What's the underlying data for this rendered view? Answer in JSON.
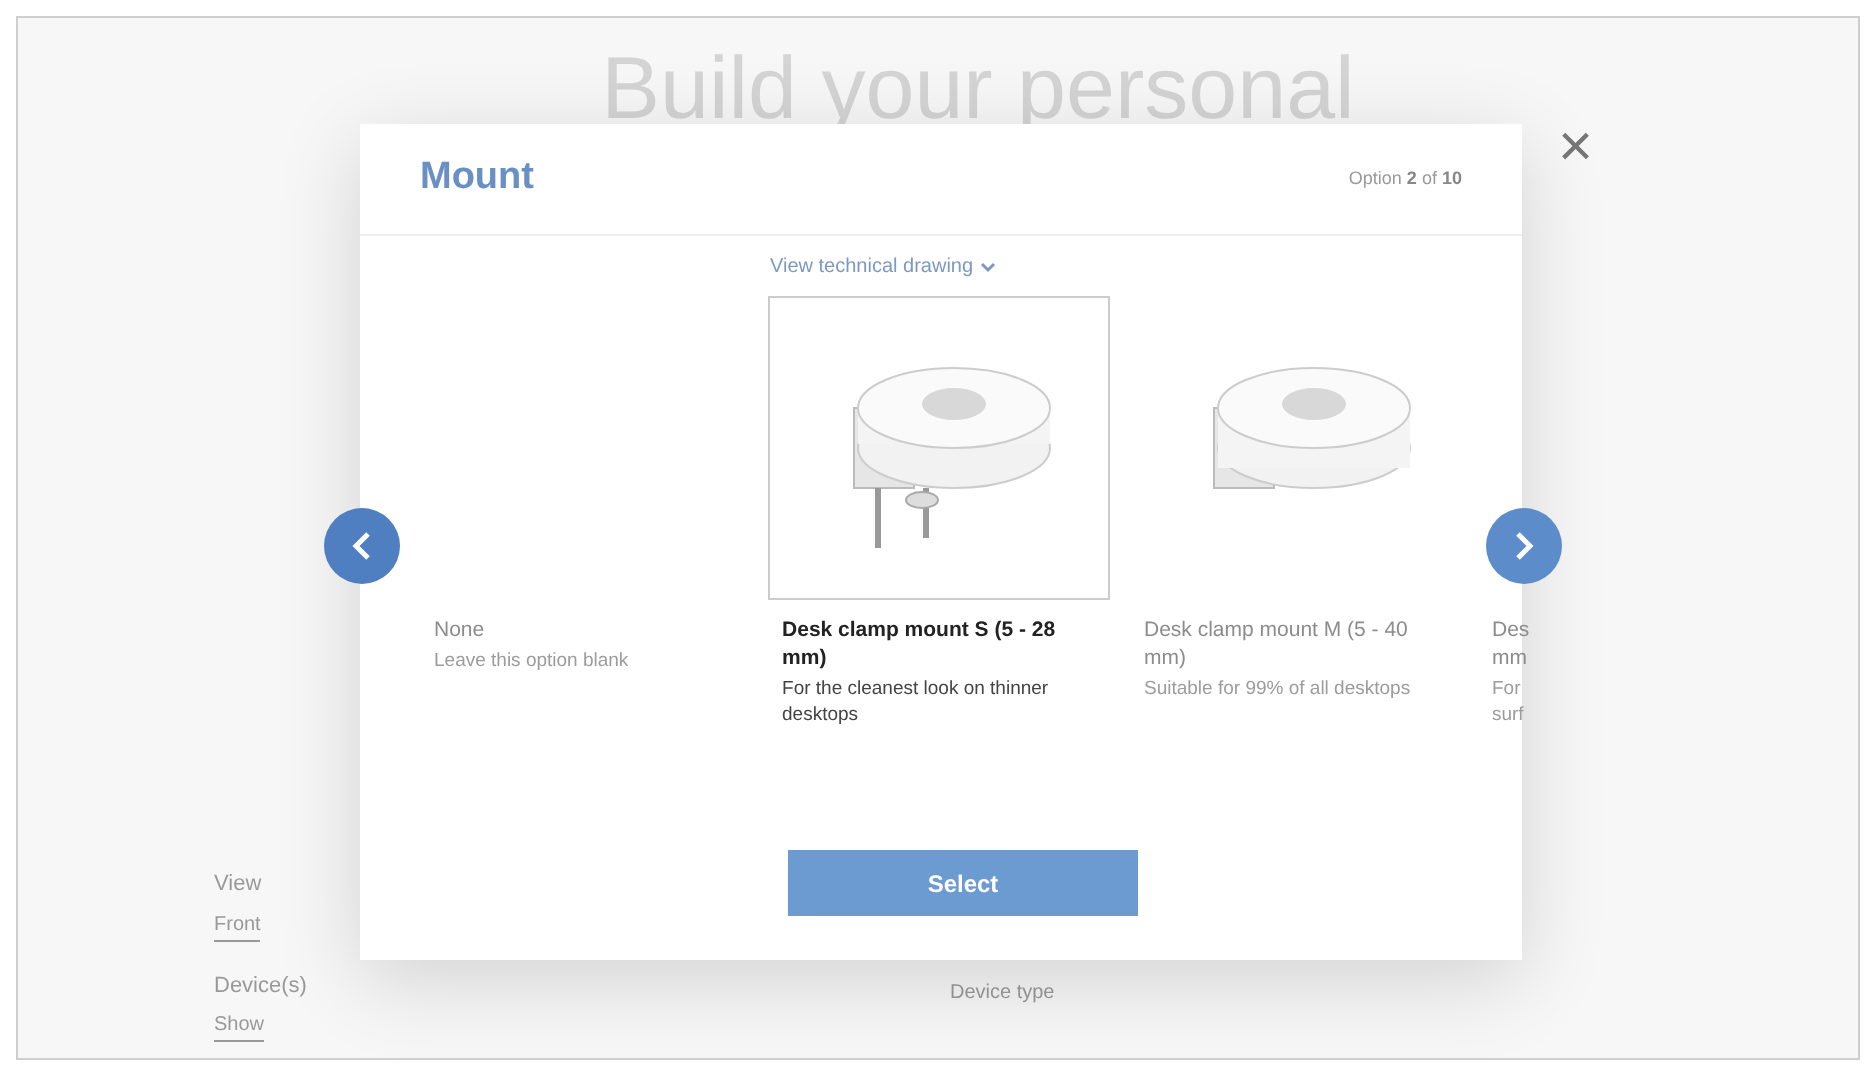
{
  "background": {
    "heading": "Build your personal",
    "settings": [
      {
        "label": "View",
        "options": [
          {
            "label": "Front",
            "selected": true
          }
        ]
      },
      {
        "label": "Device(s)",
        "options": [
          {
            "label": "Show",
            "selected": true
          }
        ]
      }
    ],
    "spec": {
      "label": "Device type"
    }
  },
  "close": "×",
  "modal": {
    "title": "Mount",
    "option_prefix": "Option",
    "option_current": "2",
    "option_sep": "of",
    "option_total": "10",
    "drawing_link": "View technical drawing",
    "options": [
      {
        "kind": "blank",
        "title_lines": [
          "None"
        ],
        "description_lines": [
          "Leave this option blank"
        ],
        "selected": false
      },
      {
        "kind": "clamp",
        "title_lines": [
          "Desk clamp mount S (5 - 28",
          "mm)"
        ],
        "description_lines": [
          "For the cleanest look on thinner",
          "desktops"
        ],
        "selected": true
      },
      {
        "kind": "clamp",
        "title_lines": [
          "Desk clamp mount M (5 - 40",
          "mm)"
        ],
        "description_lines": [
          "Suitable for 99% of all desktops"
        ],
        "selected": false
      },
      {
        "kind": "cut",
        "title_lines": [
          "Des",
          "mm"
        ],
        "description_lines": [
          "For",
          "surf"
        ],
        "selected": false
      }
    ],
    "select_button": "Select"
  }
}
